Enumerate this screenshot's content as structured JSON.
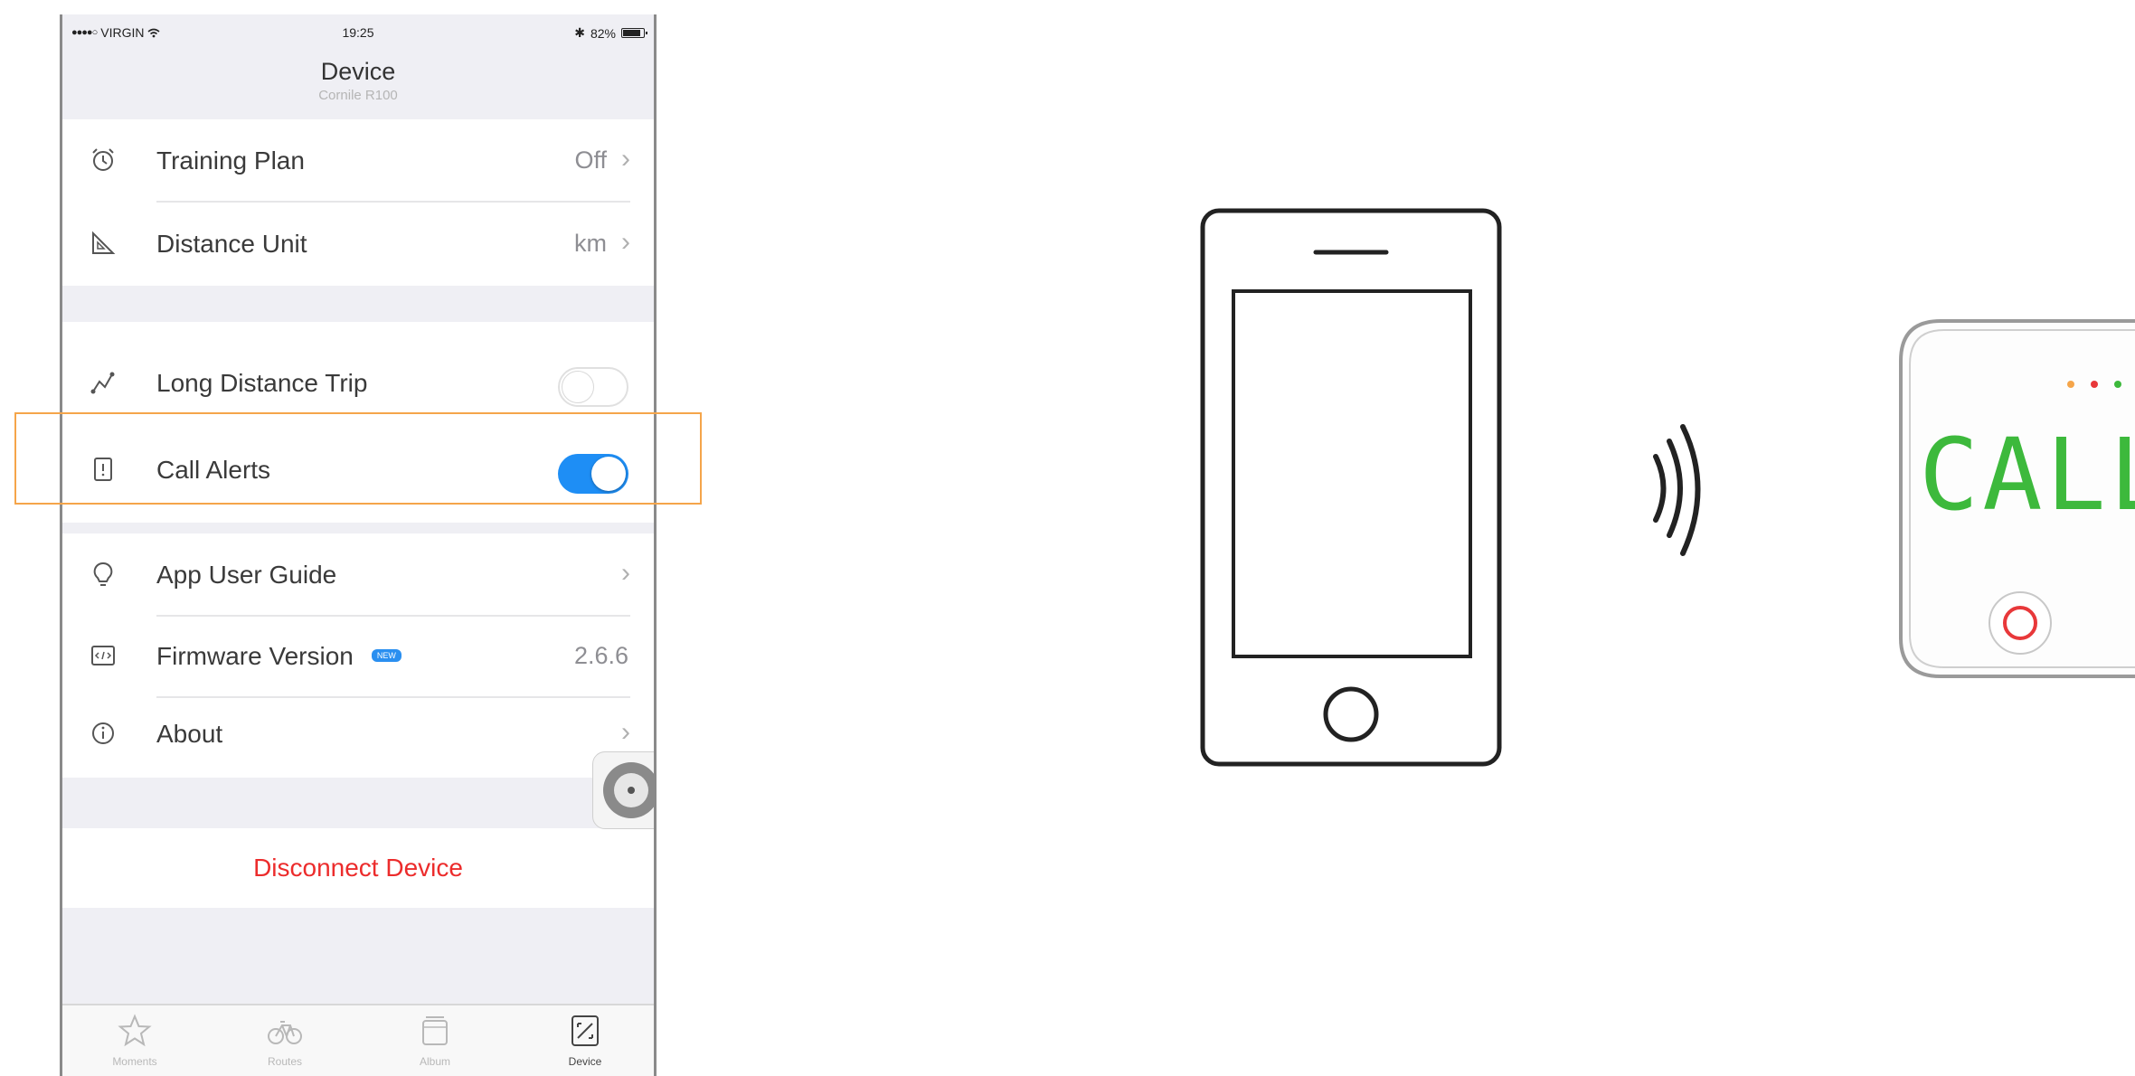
{
  "status_bar": {
    "carrier": "VIRGIN",
    "time": "19:25",
    "battery": "82%"
  },
  "nav": {
    "title": "Device",
    "subtitle": "Cornile R100"
  },
  "settings": {
    "training_plan": {
      "label": "Training Plan",
      "value": "Off",
      "icon": "alarm-clock-icon"
    },
    "distance_unit": {
      "label": "Distance Unit",
      "value": "km",
      "icon": "set-square-icon"
    },
    "long_distance_trip": {
      "label": "Long Distance Trip",
      "enabled": false,
      "icon": "route-icon"
    },
    "call_alerts": {
      "label": "Call Alerts",
      "enabled": true,
      "icon": "phone-alert-icon"
    },
    "app_user_guide": {
      "label": "App User Guide",
      "icon": "lightbulb-icon"
    },
    "firmware_version": {
      "label": "Firmware Version",
      "badge": "NEW",
      "value": "2.6.6",
      "icon": "code-icon"
    },
    "about": {
      "label": "About",
      "icon": "info-circle-icon"
    }
  },
  "disconnect": {
    "label": "Disconnect Device"
  },
  "tabs": [
    {
      "label": "Moments",
      "icon": "star-icon",
      "active": false
    },
    {
      "label": "Routes",
      "icon": "bicycle-icon",
      "active": false
    },
    {
      "label": "Album",
      "icon": "album-icon",
      "active": false
    },
    {
      "label": "Device",
      "icon": "device-icon",
      "active": true
    }
  ],
  "illustration": {
    "device_display": "CALL",
    "accent_color": "#f5a54a",
    "display_color": "#3db93c"
  }
}
